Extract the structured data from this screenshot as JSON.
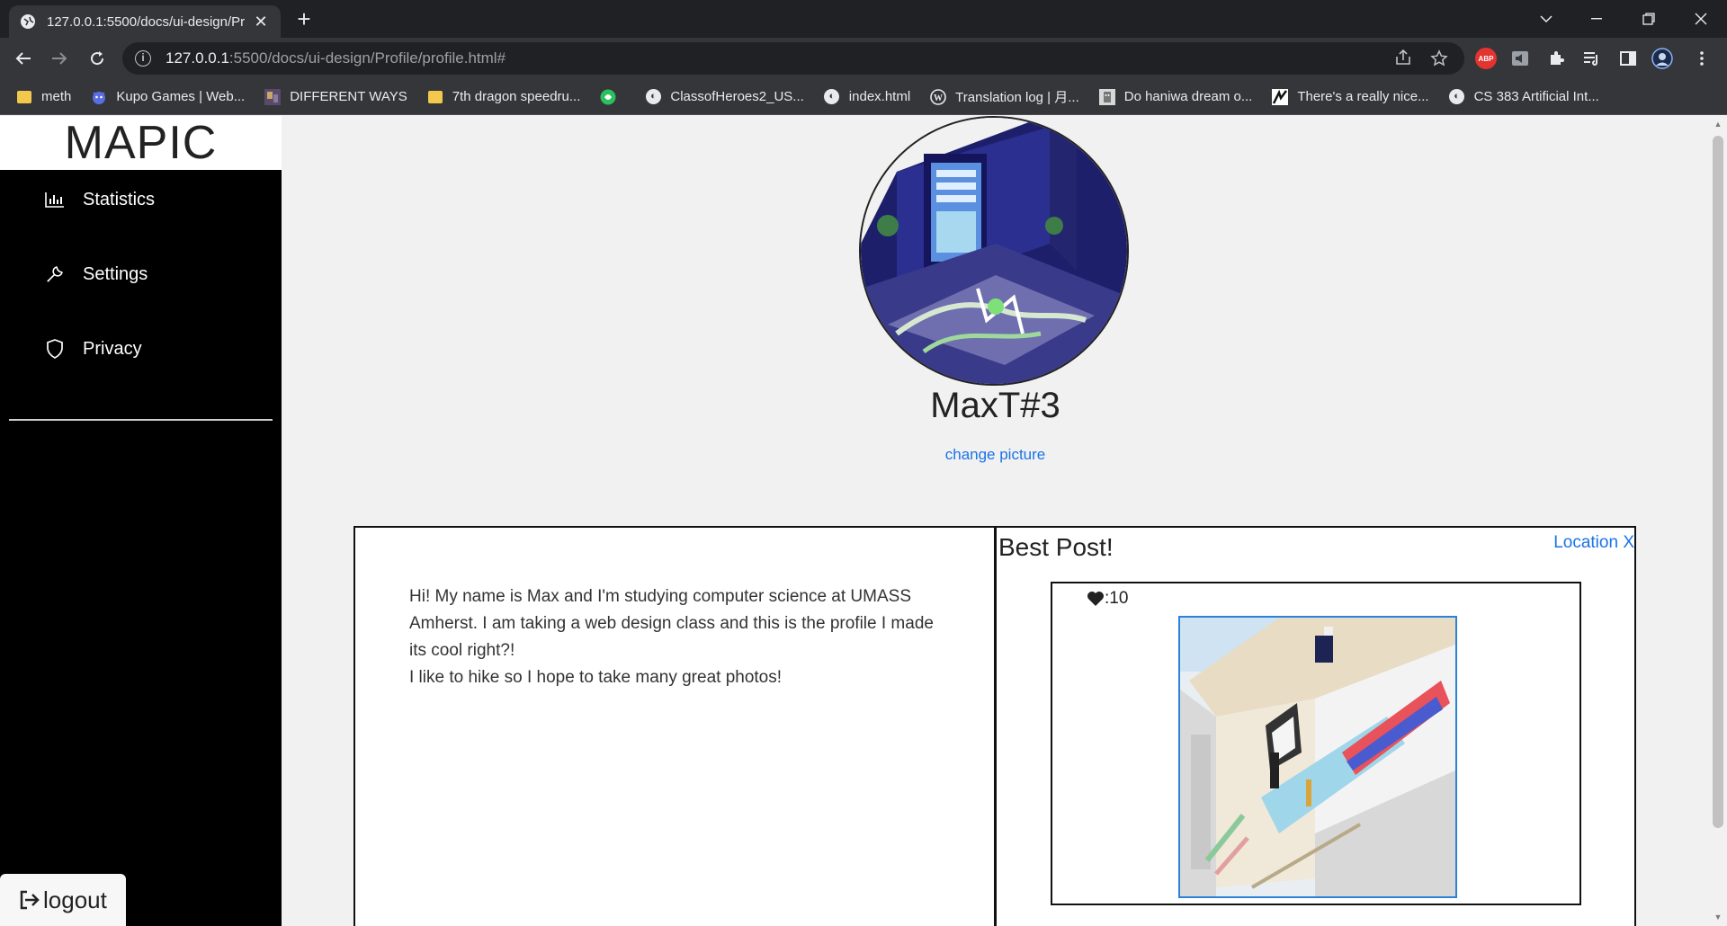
{
  "browser": {
    "tab_title": "127.0.0.1:5500/docs/ui-design/Pr",
    "url_host": "127.0.0.1",
    "url_path": ":5500/docs/ui-design/Profile/profile.html#",
    "bookmarks": [
      {
        "label": "meth",
        "icon": "folder"
      },
      {
        "label": "Kupo Games | Web...",
        "icon": "kupo"
      },
      {
        "label": "DIFFERENT WAYS",
        "icon": "image"
      },
      {
        "label": "7th dragon speedru...",
        "icon": "folder"
      },
      {
        "label": "",
        "icon": "green-globe"
      },
      {
        "label": "ClassofHeroes2_US...",
        "icon": "globe"
      },
      {
        "label": "index.html",
        "icon": "globe"
      },
      {
        "label": "Translation log | 月...",
        "icon": "wordpress"
      },
      {
        "label": "Do haniwa dream o...",
        "icon": "image"
      },
      {
        "label": "There's a really nice...",
        "icon": "image"
      },
      {
        "label": "CS 383 Artificial Int...",
        "icon": "globe"
      }
    ]
  },
  "sidebar": {
    "brand": "MAPIC",
    "items": [
      {
        "label": "Statistics",
        "icon": "bar-chart-icon"
      },
      {
        "label": "Settings",
        "icon": "wrench-icon"
      },
      {
        "label": "Privacy",
        "icon": "shield-icon"
      }
    ],
    "logout_label": "logout"
  },
  "profile": {
    "username": "MaxT#3",
    "change_picture": "change picture",
    "bio": [
      "Hi! My name is Max and I'm studying computer science at UMASS Amherst. I am taking a web design class and this is the profile I made its cool right?!",
      "I like to hike so I hope to take many great photos!"
    ]
  },
  "best_post": {
    "title": "Best Post!",
    "location": "Location X",
    "likes": ":10"
  },
  "colors": {
    "sidebar_bg": "#000000",
    "link": "#1a73e8",
    "page_bg": "#f1f1f1"
  }
}
